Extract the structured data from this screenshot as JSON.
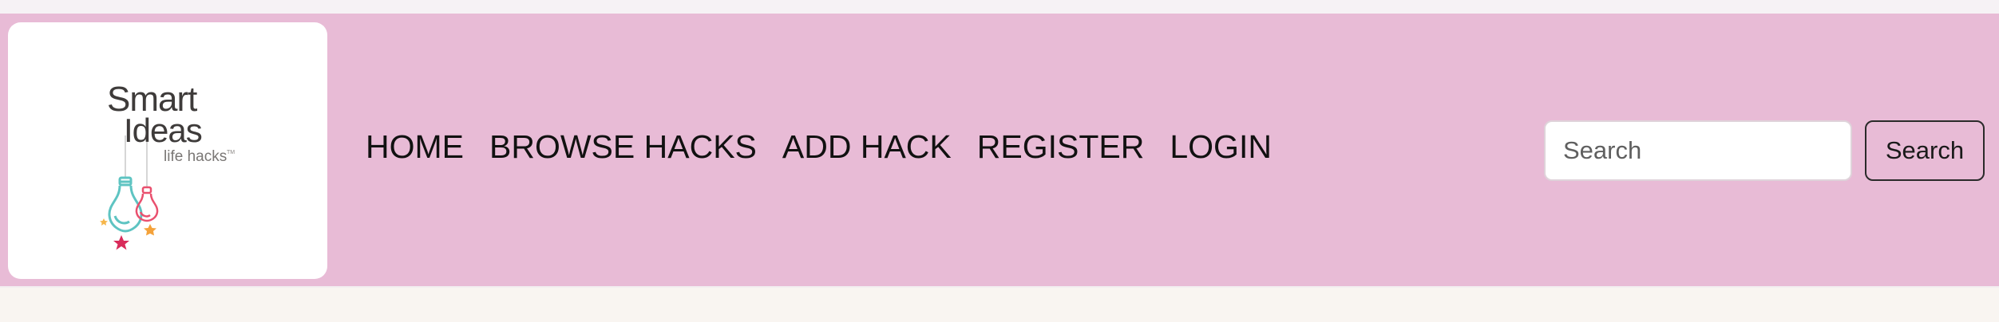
{
  "brand": {
    "logo_line1": "Smart",
    "logo_line2": "Ideas",
    "logo_line3": "life hacks",
    "logo_tm": "TM"
  },
  "nav": {
    "items": [
      {
        "label": "HOME"
      },
      {
        "label": "BROWSE HACKS"
      },
      {
        "label": "ADD HACK"
      },
      {
        "label": "REGISTER"
      },
      {
        "label": "LOGIN"
      }
    ]
  },
  "search": {
    "placeholder": "Search",
    "value": "",
    "button_label": "Search"
  },
  "colors": {
    "navbar_bg": "#e8bbd6",
    "page_bg": "#f9f5f1",
    "logo_bulb_teal": "#5ec4c2",
    "logo_bulb_pink": "#e9506e",
    "logo_star_orange": "#f4a23a"
  }
}
